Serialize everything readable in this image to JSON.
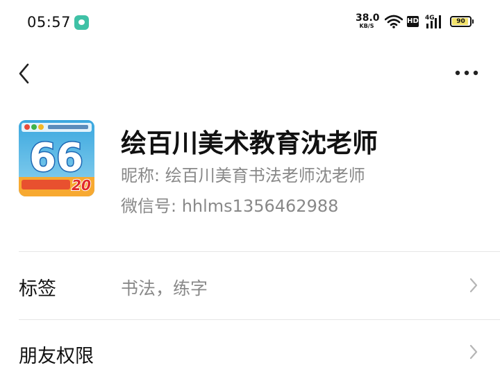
{
  "status_bar": {
    "time": "05:57",
    "net_speed_value": "38.0",
    "net_speed_unit": "KB/S",
    "hd_badge": "HD",
    "network_type": "4G",
    "battery_level": "90",
    "battery_fraction": 0.9
  },
  "header": {
    "back_icon": "chevron-left-icon",
    "more_icon": "more-dots-icon"
  },
  "profile": {
    "avatar_text": "66",
    "avatar_banner_number": "20",
    "display_name": "绘百川美术教育沈老师",
    "nickname_line": "昵称: 绘百川美育书法老师沈老师",
    "wechat_id_line": "微信号: hhlms1356462988"
  },
  "rows": [
    {
      "label": "标签",
      "value": "书法，练字"
    },
    {
      "label": "朋友权限",
      "value": ""
    }
  ],
  "colors": {
    "accent_icon": "#3fc1a6",
    "secondary_text": "#888888",
    "divider": "#e6e6e6"
  }
}
